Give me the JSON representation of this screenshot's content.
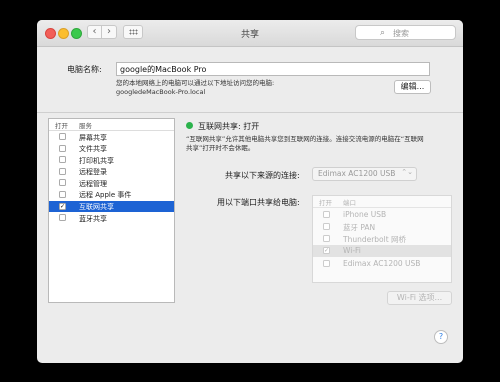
{
  "window": {
    "title": "共享"
  },
  "search": {
    "placeholder": "搜索"
  },
  "computer_name": {
    "label": "电脑名称:",
    "value": "google的MacBook Pro",
    "hint_line1": "您的本地网络上的电脑可以通过以下地址访问您的电脑:",
    "hint_line2": "googledeMacBook-Pro.local",
    "edit_label": "编辑..."
  },
  "services": {
    "col_on": "打开",
    "col_service": "服务",
    "items": [
      {
        "label": "屏幕共享",
        "checked": false,
        "selected": false
      },
      {
        "label": "文件共享",
        "checked": false,
        "selected": false
      },
      {
        "label": "打印机共享",
        "checked": false,
        "selected": false
      },
      {
        "label": "远程登录",
        "checked": false,
        "selected": false
      },
      {
        "label": "远程管理",
        "checked": false,
        "selected": false
      },
      {
        "label": "远程 Apple 事件",
        "checked": false,
        "selected": false
      },
      {
        "label": "互联网共享",
        "checked": true,
        "selected": true
      },
      {
        "label": "蓝牙共享",
        "checked": false,
        "selected": false
      }
    ]
  },
  "detail": {
    "status": "互联网共享: 打开",
    "status_color": "#2bb24c",
    "desc_line1": "“互联网共享”允许其他电脑共享您到互联网的连接。连接交流电源的电脑在“互联网",
    "desc_line2": "共享”打开时不会休眠。",
    "share_from_label": "共享以下来源的连接:",
    "share_from_value": "Edimax AC1200 USB",
    "to_ports_label": "用以下端口共享给电脑:",
    "port_col_on": "打开",
    "port_col_port": "端口",
    "ports": [
      {
        "label": "iPhone USB",
        "checked": false,
        "selected": false
      },
      {
        "label": "蓝牙 PAN",
        "checked": false,
        "selected": false
      },
      {
        "label": "Thunderbolt 网桥",
        "checked": false,
        "selected": false
      },
      {
        "label": "Wi-Fi",
        "checked": true,
        "selected": true
      },
      {
        "label": "Edimax AC1200 USB",
        "checked": false,
        "selected": false
      }
    ],
    "wifi_options_label": "Wi-Fi 选项..."
  },
  "help": {
    "label": "?"
  }
}
